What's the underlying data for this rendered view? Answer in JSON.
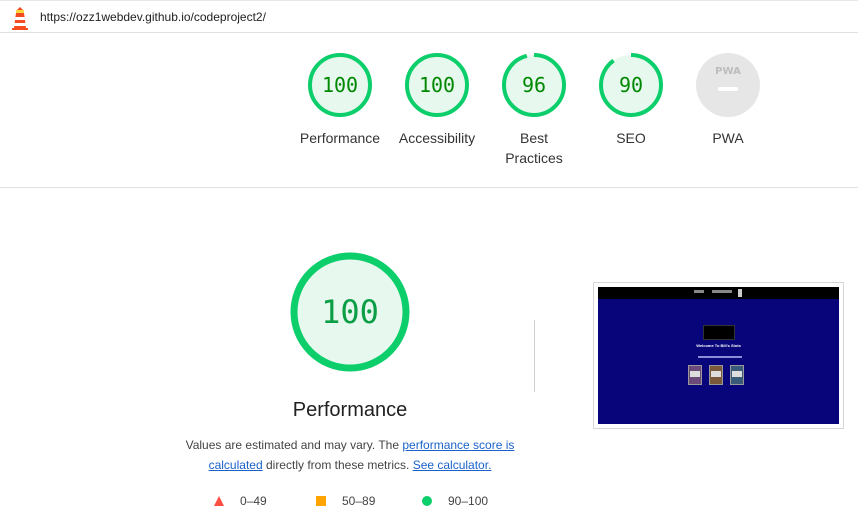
{
  "header": {
    "url": "https://ozz1webdev.github.io/codeproject2/",
    "logo_icon": "lighthouse-icon"
  },
  "categories": [
    {
      "label": "Performance",
      "score": "100",
      "value": 100,
      "color": "#0cce6b"
    },
    {
      "label": "Accessibility",
      "score": "100",
      "value": 100,
      "color": "#0cce6b"
    },
    {
      "label": "Best Practices",
      "score": "96",
      "value": 96,
      "color": "#0cce6b"
    },
    {
      "label": "SEO",
      "score": "90",
      "value": 90,
      "color": "#0cce6b"
    },
    {
      "label": "PWA",
      "score": "",
      "badge": "PWA",
      "value": null,
      "color": "#9e9e9e"
    }
  ],
  "performance": {
    "score": "100",
    "value": 100,
    "title": "Performance",
    "desc_prefix": "Values are estimated and may vary. The ",
    "link1": "performance score is calculated",
    "desc_middle": " directly from these metrics. ",
    "link2": "See calculator."
  },
  "legend": [
    {
      "range": "0–49",
      "shape": "triangle",
      "color": "#ff4e42"
    },
    {
      "range": "50–89",
      "shape": "square",
      "color": "#ffa400"
    },
    {
      "range": "90–100",
      "shape": "circle",
      "color": "#0cce6b"
    }
  ],
  "screenshot": {
    "heading": "Welcome To Bill's Slots"
  }
}
